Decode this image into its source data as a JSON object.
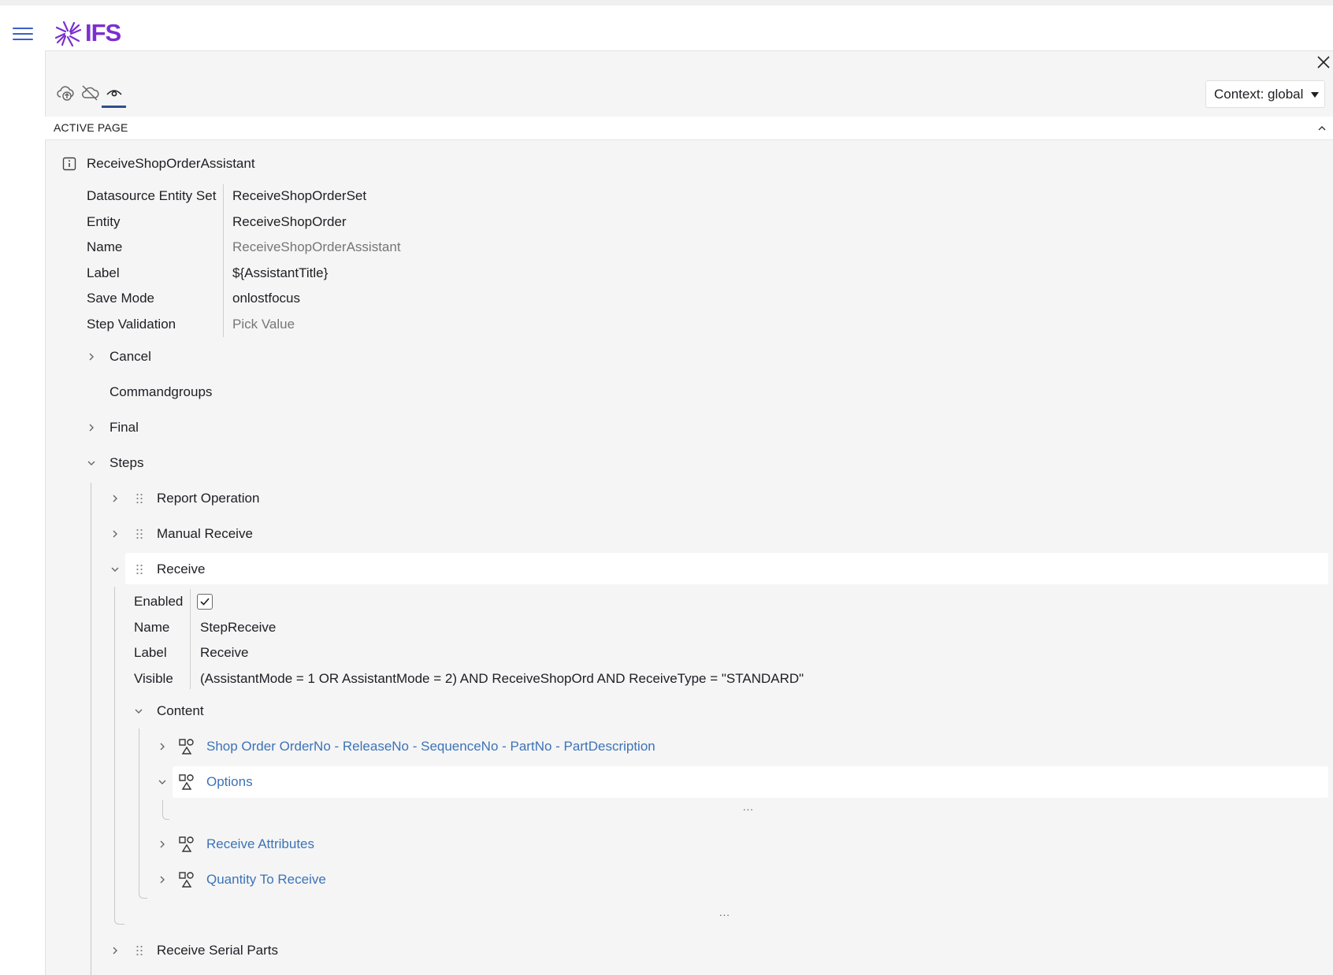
{
  "app": {
    "logo_text": "IFS"
  },
  "toolbar": {
    "context_label": "Context: global"
  },
  "section": {
    "title": "ACTIVE PAGE"
  },
  "page": {
    "name": "ReceiveShopOrderAssistant",
    "props": [
      {
        "key": "Datasource Entity Set",
        "value": "ReceiveShopOrderSet"
      },
      {
        "key": "Entity",
        "value": "ReceiveShopOrder"
      },
      {
        "key": "Name",
        "value": "ReceiveShopOrderAssistant"
      },
      {
        "key": "Label",
        "value": "${AssistantTitle}"
      },
      {
        "key": "Save Mode",
        "value": "onlostfocus"
      },
      {
        "key": "Step Validation",
        "value": "Pick Value"
      }
    ]
  },
  "tree": {
    "cancel": "Cancel",
    "commandgroups": "Commandgroups",
    "final": "Final",
    "steps": "Steps",
    "step_items": [
      "Report Operation",
      "Manual Receive",
      "Receive",
      "Receive Serial Parts"
    ],
    "receive_props": [
      {
        "key": "Enabled",
        "value": ""
      },
      {
        "key": "Name",
        "value": "StepReceive"
      },
      {
        "key": "Label",
        "value": "Receive"
      },
      {
        "key": "Visible",
        "value": "(AssistantMode = 1 OR AssistantMode = 2) AND ReceiveShopOrd AND ReceiveType = \"STANDARD\""
      }
    ],
    "content": "Content",
    "groups": [
      "Shop Order OrderNo - ReleaseNo - SequenceNo - PartNo - PartDescription",
      "Options",
      "Receive Attributes",
      "Quantity To Receive"
    ],
    "ellipsis": "..."
  },
  "colors": {
    "accent": "#3c73b8",
    "brand": "#7b2fd0",
    "text": "#1e1e24",
    "muted": "#767676"
  },
  "icons": [
    "menu-icon",
    "ifs-logo",
    "close-icon",
    "cloud-upload-icon",
    "cloud-off-icon",
    "eye-icon",
    "chevron-up-icon",
    "info-icon",
    "chevron-right-icon",
    "chevron-down-icon",
    "drag-handle-icon",
    "group-icon",
    "checkmark-icon"
  ]
}
